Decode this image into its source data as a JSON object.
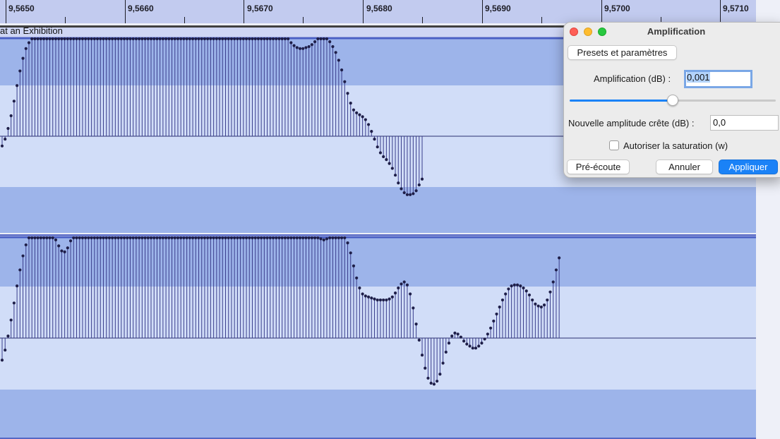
{
  "ruler": {
    "ticks": [
      "9,5650",
      "9,5660",
      "9,5670",
      "9,5680",
      "9,5690",
      "9,5700",
      "9,5710"
    ]
  },
  "track": {
    "title": "at an Exhibition"
  },
  "waveform": {
    "color_fill": "#9db4ea",
    "color_highlight": "#d1ddf8",
    "color_stem": "#3a3e8c",
    "color_point": "#1e1e48",
    "channel1_samples": [
      -0.1,
      -0.03,
      0.08,
      0.21,
      0.36,
      0.52,
      0.67,
      0.8,
      0.9,
      0.96,
      1,
      1,
      1,
      1,
      1,
      1,
      1,
      1,
      1,
      1,
      1,
      1,
      1,
      1,
      1,
      1,
      1,
      1,
      1,
      1,
      1,
      1,
      1,
      1,
      1,
      1,
      1,
      1,
      1,
      1,
      1,
      1,
      1,
      1,
      1,
      1,
      1,
      1,
      1,
      1,
      1,
      1,
      1,
      1,
      1,
      1,
      1,
      1,
      1,
      1,
      1,
      1,
      1,
      1,
      1,
      1,
      1,
      1,
      1,
      1,
      1,
      1,
      1,
      1,
      1,
      1,
      1,
      1,
      1,
      1,
      1,
      1,
      1,
      1,
      1,
      1,
      1,
      1,
      1,
      1,
      1,
      1,
      1,
      1,
      1,
      1,
      1,
      0.96,
      0.93,
      0.91,
      0.9,
      0.9,
      0.91,
      0.92,
      0.94,
      0.97,
      1,
      1,
      1,
      1,
      0.97,
      0.92,
      0.86,
      0.78,
      0.68,
      0.56,
      0.44,
      0.34,
      0.27,
      0.24,
      0.22,
      0.2,
      0.17,
      0.12,
      0.05,
      -0.03,
      -0.11,
      -0.17,
      -0.21,
      -0.24,
      -0.28,
      -0.33,
      -0.4,
      -0.48,
      -0.54,
      -0.58,
      -0.6,
      -0.6,
      -0.59,
      -0.56,
      -0.5,
      -0.44
    ],
    "channel2_samples": [
      -0.22,
      -0.12,
      0.02,
      0.18,
      0.35,
      0.52,
      0.68,
      0.82,
      0.93,
      1,
      1,
      1,
      1,
      1,
      1,
      1,
      1,
      1,
      0.98,
      0.92,
      0.87,
      0.86,
      0.9,
      0.97,
      1,
      1,
      1,
      1,
      1,
      1,
      1,
      1,
      1,
      1,
      1,
      1,
      1,
      1,
      1,
      1,
      1,
      1,
      1,
      1,
      1,
      1,
      1,
      1,
      1,
      1,
      1,
      1,
      1,
      1,
      1,
      1,
      1,
      1,
      1,
      1,
      1,
      1,
      1,
      1,
      1,
      1,
      1,
      1,
      1,
      1,
      1,
      1,
      1,
      1,
      1,
      1,
      1,
      1,
      1,
      1,
      1,
      1,
      1,
      1,
      1,
      1,
      1,
      1,
      1,
      1,
      1,
      1,
      1,
      1,
      1,
      1,
      1,
      1,
      1,
      1,
      1,
      1,
      1,
      1,
      1,
      1,
      1,
      0.99,
      0.98,
      0.99,
      1,
      1,
      1,
      1,
      1,
      1,
      0.95,
      0.85,
      0.72,
      0.6,
      0.5,
      0.44,
      0.42,
      0.41,
      0.4,
      0.39,
      0.38,
      0.38,
      0.38,
      0.38,
      0.39,
      0.41,
      0.45,
      0.5,
      0.54,
      0.56,
      0.53,
      0.44,
      0.3,
      0.14,
      -0.02,
      -0.17,
      -0.3,
      -0.4,
      -0.45,
      -0.46,
      -0.43,
      -0.36,
      -0.25,
      -0.14,
      -0.05,
      0.02,
      0.05,
      0.04,
      0.01,
      -0.03,
      -0.06,
      -0.08,
      -0.1,
      -0.1,
      -0.08,
      -0.05,
      -0.01,
      0.04,
      0.1,
      0.17,
      0.24,
      0.31,
      0.38,
      0.44,
      0.49,
      0.52,
      0.53,
      0.53,
      0.52,
      0.5,
      0.47,
      0.43,
      0.38,
      0.34,
      0.32,
      0.31,
      0.33,
      0.38,
      0.46,
      0.56,
      0.68,
      0.8
    ]
  },
  "dialog": {
    "title": "Amplification",
    "presets_label": "Presets et paramètres",
    "amp_label": "Amplification (dB) :",
    "amp_value": "0,001",
    "slider_fraction": 0.5,
    "peak_label": "Nouvelle amplitude crête (dB) :",
    "peak_value": "0,0",
    "clip_label": "Autoriser la saturation (w)",
    "preview_label": "Pré-écoute",
    "cancel_label": "Annuler",
    "apply_label": "Appliquer"
  }
}
